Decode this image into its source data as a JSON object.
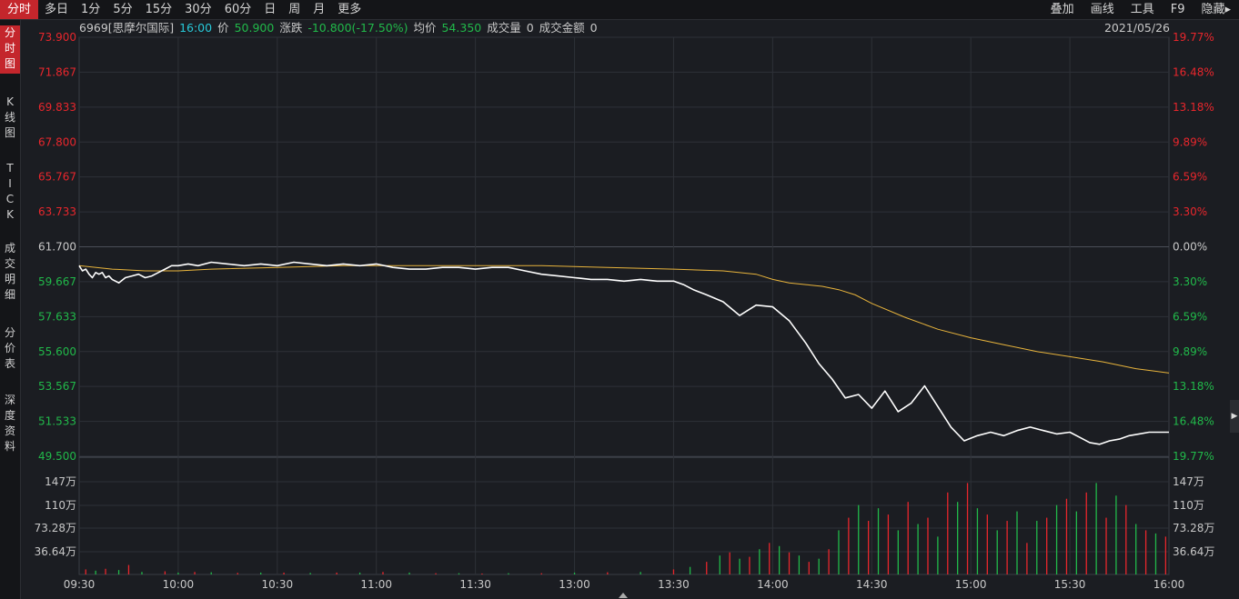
{
  "tabs": [
    "分时",
    "多日",
    "1分",
    "5分",
    "15分",
    "30分",
    "60分",
    "日",
    "周",
    "月",
    "更多"
  ],
  "active_tab": 0,
  "right_tools": [
    "叠加",
    "画线",
    "工具",
    "F9",
    "隐藏▸"
  ],
  "sidebar": [
    "分\n时\n图",
    "K\n线\n图",
    "T\nI\nC\nK",
    "成\n交\n明\n细",
    "分\n价\n表",
    "深\n度\n资\n料"
  ],
  "info": {
    "code_name": "6969[思摩尔国际]",
    "time": "16:00",
    "price_label": "价",
    "price": "50.900",
    "change_label": "涨跌",
    "change": "-10.800(-17.50%)",
    "avg_label": "均价",
    "avg": "54.350",
    "volume_label": "成交量",
    "volume": "0",
    "amount_label": "成交金额",
    "amount": "0",
    "date": "2021/05/26"
  },
  "colors": {
    "up": "#e8262c",
    "down": "#21b94a",
    "price_line": "#ffffff",
    "avg_line": "#e8b43c",
    "grid": "#2e3138"
  },
  "chart_data": {
    "type": "line",
    "prev_close": 61.7,
    "price_ticks": [
      "73.900",
      "71.867",
      "69.833",
      "67.800",
      "65.767",
      "63.733",
      "61.700",
      "59.667",
      "57.633",
      "55.600",
      "53.567",
      "51.533",
      "49.500"
    ],
    "pct_ticks": [
      "19.77%",
      "16.48%",
      "13.18%",
      "9.89%",
      "6.59%",
      "3.30%",
      "0.00%",
      "3.30%",
      "6.59%",
      "9.89%",
      "13.18%",
      "16.48%",
      "19.77%"
    ],
    "ylim": [
      49.5,
      73.9
    ],
    "volume_ticks": [
      "147万",
      "110万",
      "73.28万",
      "36.64万"
    ],
    "volume_max": 1470000,
    "x_ticks": [
      "09:30",
      "10:00",
      "10:30",
      "11:00",
      "11:30",
      "13:00",
      "13:30",
      "14:00",
      "14:30",
      "15:00",
      "15:30",
      "16:00"
    ],
    "price_series": {
      "t": [
        0,
        1,
        2,
        3,
        4,
        5,
        6,
        7,
        8,
        9,
        10,
        12,
        14,
        16,
        18,
        20,
        22,
        24,
        26,
        28,
        30,
        33,
        36,
        40,
        45,
        50,
        55,
        60,
        65,
        70,
        75,
        80,
        85,
        90,
        95,
        100,
        105,
        110,
        115,
        120,
        125,
        130,
        135,
        140,
        145,
        150,
        155,
        160,
        165,
        170,
        175,
        180,
        183,
        186,
        190,
        195,
        200,
        205,
        210,
        215,
        220,
        224,
        228,
        232,
        236,
        240,
        244,
        248,
        252,
        256,
        260,
        264,
        268,
        272,
        276,
        280,
        284,
        288,
        292,
        296,
        300,
        303,
        306,
        309,
        312,
        315,
        318,
        321,
        324,
        327,
        330
      ],
      "v": [
        60.6,
        60.3,
        60.4,
        60.1,
        59.9,
        60.2,
        60.1,
        60.2,
        59.9,
        60.0,
        59.8,
        59.6,
        59.9,
        60.0,
        60.1,
        59.9,
        60.0,
        60.2,
        60.4,
        60.6,
        60.6,
        60.7,
        60.6,
        60.8,
        60.7,
        60.6,
        60.7,
        60.6,
        60.8,
        60.7,
        60.6,
        60.7,
        60.6,
        60.7,
        60.5,
        60.4,
        60.4,
        60.5,
        60.5,
        60.4,
        60.5,
        60.5,
        60.3,
        60.1,
        60.0,
        59.9,
        59.8,
        59.8,
        59.7,
        59.8,
        59.7,
        59.7,
        59.5,
        59.2,
        58.9,
        58.5,
        57.7,
        58.3,
        58.2,
        57.4,
        56.1,
        54.9,
        54.0,
        52.9,
        53.1,
        52.3,
        53.3,
        52.1,
        52.6,
        53.6,
        52.4,
        51.2,
        50.4,
        50.7,
        50.9,
        50.7,
        51.0,
        51.2,
        51.0,
        50.8,
        50.9,
        50.6,
        50.3,
        50.2,
        50.4,
        50.5,
        50.7,
        50.8,
        50.9,
        50.9,
        50.9
      ]
    },
    "avg_series": {
      "t": [
        0,
        10,
        20,
        30,
        40,
        60,
        80,
        100,
        120,
        140,
        160,
        180,
        195,
        205,
        210,
        215,
        220,
        225,
        230,
        235,
        240,
        250,
        260,
        270,
        280,
        290,
        300,
        310,
        320,
        330
      ],
      "v": [
        60.6,
        60.4,
        60.3,
        60.3,
        60.4,
        60.5,
        60.6,
        60.6,
        60.6,
        60.6,
        60.5,
        60.4,
        60.3,
        60.1,
        59.8,
        59.6,
        59.5,
        59.4,
        59.2,
        58.9,
        58.4,
        57.6,
        56.9,
        56.4,
        56.0,
        55.6,
        55.3,
        55.0,
        54.6,
        54.35
      ]
    },
    "volume_series": {
      "t": [
        2,
        5,
        8,
        12,
        15,
        19,
        26,
        30,
        35,
        40,
        48,
        55,
        62,
        70,
        78,
        85,
        92,
        100,
        108,
        115,
        122,
        130,
        140,
        150,
        160,
        170,
        180,
        185,
        190,
        194,
        197,
        200,
        203,
        206,
        209,
        212,
        215,
        218,
        221,
        224,
        227,
        230,
        233,
        236,
        239,
        242,
        245,
        248,
        251,
        254,
        257,
        260,
        263,
        266,
        269,
        272,
        275,
        278,
        281,
        284,
        287,
        290,
        293,
        296,
        299,
        302,
        305,
        308,
        311,
        314,
        317,
        320,
        323,
        326,
        329
      ],
      "v": [
        80000,
        60000,
        90000,
        70000,
        150000,
        40000,
        50000,
        30000,
        40000,
        35000,
        25000,
        30000,
        30000,
        25000,
        30000,
        30000,
        40000,
        30000,
        20000,
        20000,
        15000,
        20000,
        20000,
        30000,
        35000,
        40000,
        80000,
        120000,
        200000,
        300000,
        350000,
        250000,
        280000,
        400000,
        500000,
        450000,
        350000,
        300000,
        200000,
        250000,
        400000,
        700000,
        900000,
        1100000,
        850000,
        1050000,
        950000,
        700000,
        1150000,
        800000,
        900000,
        600000,
        1300000,
        1150000,
        1450000,
        1050000,
        950000,
        700000,
        850000,
        1000000,
        500000,
        850000,
        900000,
        1100000,
        1200000,
        1000000,
        1300000,
        1450000,
        900000,
        1250000,
        1100000,
        800000,
        700000,
        650000,
        600000
      ],
      "up": [
        1,
        0,
        1,
        0,
        1,
        0,
        1,
        0,
        1,
        0,
        1,
        0,
        1,
        0,
        1,
        0,
        1,
        0,
        1,
        0,
        1,
        0,
        1,
        0,
        1,
        0,
        1,
        0,
        1,
        0,
        1,
        0,
        1,
        0,
        1,
        0,
        1,
        0,
        1,
        0,
        1,
        0,
        1,
        0,
        1,
        0,
        1,
        0,
        1,
        0,
        1,
        0,
        1,
        0,
        1,
        0,
        1,
        0,
        1,
        0,
        1,
        0,
        1,
        0,
        1,
        0,
        1,
        0,
        1,
        0,
        1,
        0,
        1,
        0,
        1
      ]
    }
  }
}
